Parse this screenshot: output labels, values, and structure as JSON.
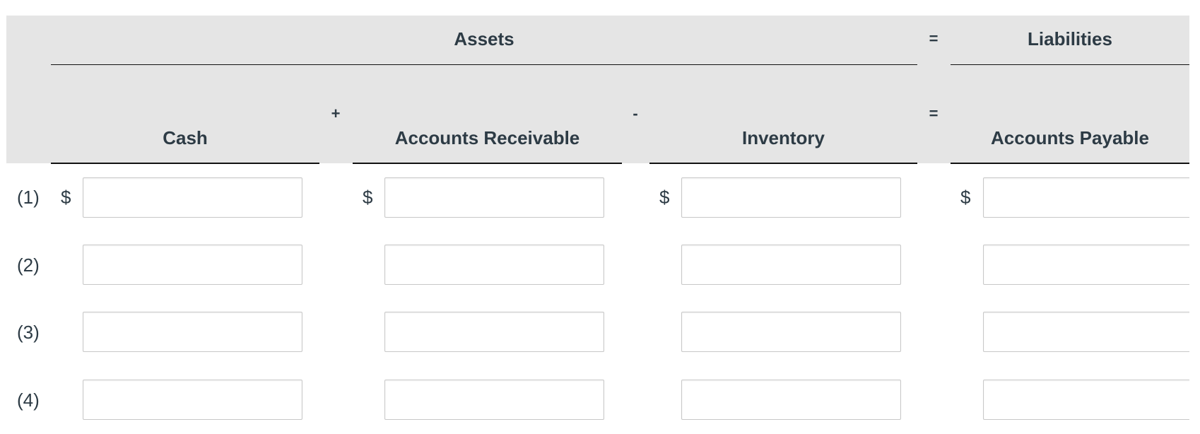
{
  "header": {
    "assets_label": "Assets",
    "liabilities_label": "Liabilities",
    "equals_top": "=",
    "columns": [
      {
        "label": "Cash"
      },
      {
        "label": "Accounts Receivable"
      },
      {
        "label": "Inventory"
      },
      {
        "label": "Accounts Payable"
      }
    ],
    "operators": [
      "+",
      "-",
      "="
    ]
  },
  "currency_symbol": "$",
  "rows": [
    {
      "label": "(1)",
      "values": [
        "",
        "",
        "",
        ""
      ]
    },
    {
      "label": "(2)",
      "values": [
        "",
        "",
        "",
        ""
      ]
    },
    {
      "label": "(3)",
      "values": [
        "",
        "",
        "",
        ""
      ]
    },
    {
      "label": "(4)",
      "values": [
        "",
        "",
        "",
        ""
      ]
    }
  ]
}
